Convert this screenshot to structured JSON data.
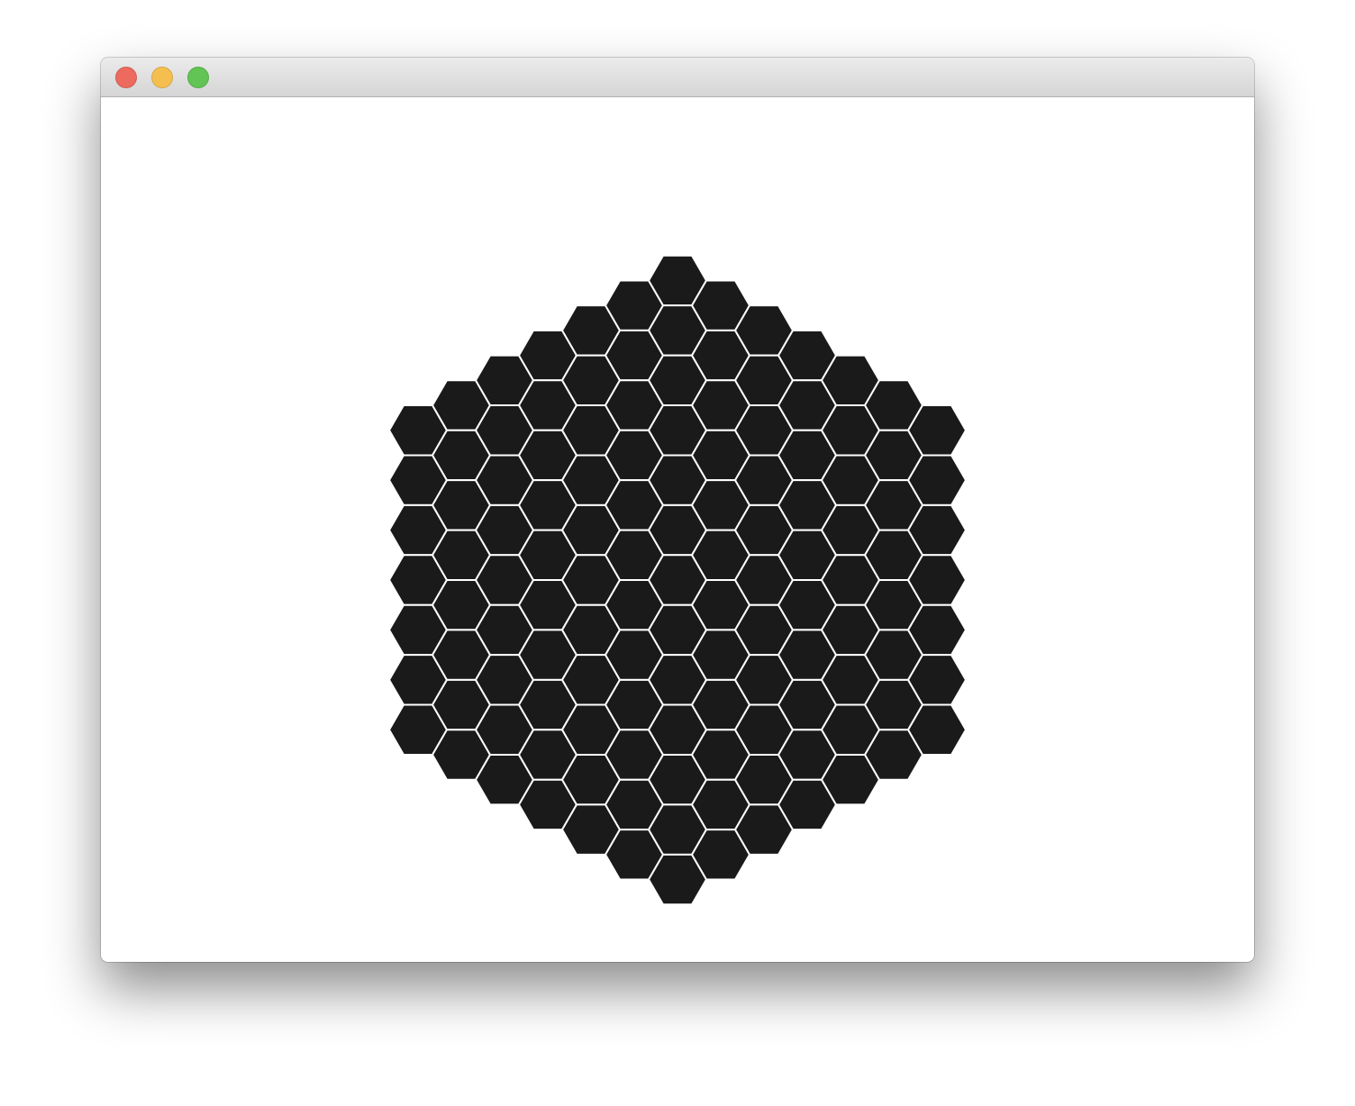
{
  "window": {
    "controls": [
      {
        "name": "close-button",
        "color": "#ed6a5e"
      },
      {
        "name": "minimize-button",
        "color": "#f5bf4f"
      },
      {
        "name": "maximize-button",
        "color": "#61c454"
      }
    ]
  },
  "board": {
    "shape": "hexagon",
    "side_cells": 7,
    "cell_fill": "#1a1a1a",
    "cell_stroke": "#ffffff",
    "background": "#ffffff"
  }
}
